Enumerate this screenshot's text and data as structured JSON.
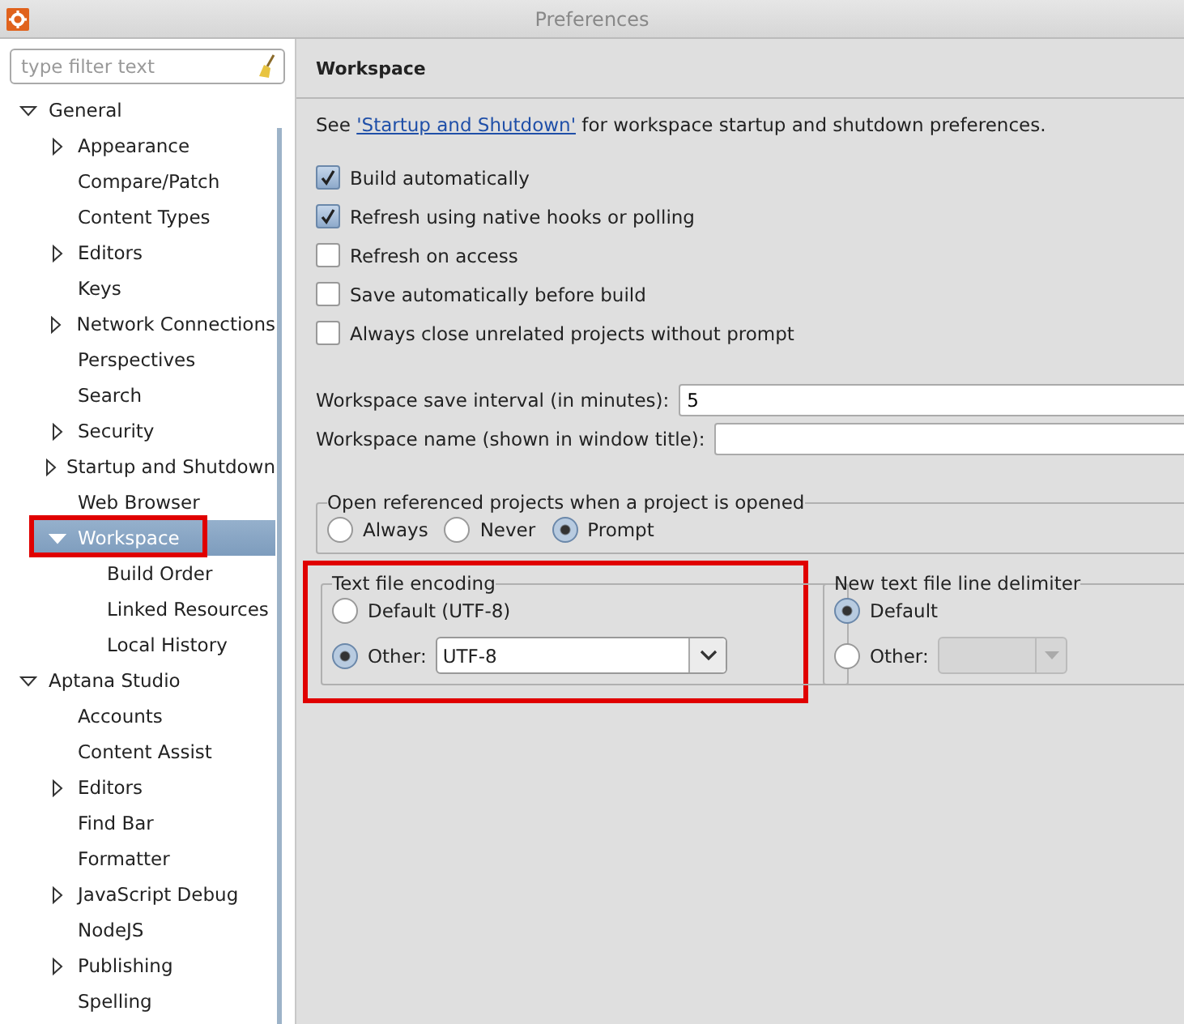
{
  "window": {
    "title": "Preferences"
  },
  "filter": {
    "placeholder": "type filter text"
  },
  "tree": [
    {
      "label": "General",
      "expanded": true,
      "selected": false,
      "highlighted": false,
      "children": [
        {
          "label": "Appearance",
          "expanded": false,
          "selected": false,
          "highlighted": false
        },
        {
          "label": "Compare/Patch",
          "selected": false,
          "highlighted": false
        },
        {
          "label": "Content Types",
          "selected": false,
          "highlighted": false
        },
        {
          "label": "Editors",
          "expanded": false,
          "selected": false,
          "highlighted": false
        },
        {
          "label": "Keys",
          "selected": false,
          "highlighted": false
        },
        {
          "label": "Network Connections",
          "expanded": false,
          "selected": false,
          "highlighted": false
        },
        {
          "label": "Perspectives",
          "selected": false,
          "highlighted": false
        },
        {
          "label": "Search",
          "selected": false,
          "highlighted": false
        },
        {
          "label": "Security",
          "expanded": false,
          "selected": false,
          "highlighted": false
        },
        {
          "label": "Startup and Shutdown",
          "expanded": false,
          "selected": false,
          "highlighted": false
        },
        {
          "label": "Web Browser",
          "selected": false,
          "highlighted": false
        },
        {
          "label": "Workspace",
          "expanded": true,
          "selected": true,
          "highlighted": true,
          "children": [
            {
              "label": "Build Order",
              "selected": false,
              "highlighted": false
            },
            {
              "label": "Linked Resources",
              "selected": false,
              "highlighted": false
            },
            {
              "label": "Local History",
              "selected": false,
              "highlighted": false
            }
          ]
        }
      ]
    },
    {
      "label": "Aptana Studio",
      "expanded": true,
      "selected": false,
      "highlighted": false,
      "children": [
        {
          "label": "Accounts",
          "selected": false,
          "highlighted": false
        },
        {
          "label": "Content Assist",
          "selected": false,
          "highlighted": false
        },
        {
          "label": "Editors",
          "expanded": false,
          "selected": false,
          "highlighted": false
        },
        {
          "label": "Find Bar",
          "selected": false,
          "highlighted": false
        },
        {
          "label": "Formatter",
          "selected": false,
          "highlighted": false
        },
        {
          "label": "JavaScript Debug",
          "expanded": false,
          "selected": false,
          "highlighted": false
        },
        {
          "label": "NodeJS",
          "selected": false,
          "highlighted": false
        },
        {
          "label": "Publishing",
          "expanded": false,
          "selected": false,
          "highlighted": false
        },
        {
          "label": "Spelling",
          "selected": false,
          "highlighted": false
        }
      ]
    }
  ],
  "page": {
    "title": "Workspace",
    "intro": {
      "before": "See",
      "link": "'Startup and Shutdown'",
      "after": "for workspace startup and shutdown preferences."
    },
    "checkboxes": [
      {
        "label": "Build automatically",
        "checked": true
      },
      {
        "label": "Refresh using native hooks or polling",
        "checked": true
      },
      {
        "label": "Refresh on access",
        "checked": false
      },
      {
        "label": "Save automatically before build",
        "checked": false
      },
      {
        "label": "Always close unrelated projects without prompt",
        "checked": false
      }
    ],
    "fields": [
      {
        "label": "Workspace save interval (in minutes):",
        "value": "5"
      },
      {
        "label": "Workspace name (shown in window title):"
      }
    ],
    "open_group": {
      "title": "Open referenced projects when a project is opened",
      "options": [
        {
          "label": "Always",
          "selected": false
        },
        {
          "label": "Never",
          "selected": false
        },
        {
          "label": "Prompt",
          "selected": true
        }
      ]
    },
    "encoding_group": {
      "title": "Text file encoding",
      "highlighted": true,
      "options": [
        {
          "label": "Default (UTF-8)",
          "selected": false
        },
        {
          "label": "Other:",
          "selected": true
        }
      ],
      "combo": {
        "value": "UTF-8",
        "disabled": false
      }
    },
    "delimiter_group": {
      "title": "New text file line delimiter",
      "highlighted": false,
      "options": [
        {
          "label": "Default",
          "selected": true
        },
        {
          "label": "Other:",
          "selected": false
        }
      ],
      "combo": {
        "disabled": true
      }
    }
  }
}
